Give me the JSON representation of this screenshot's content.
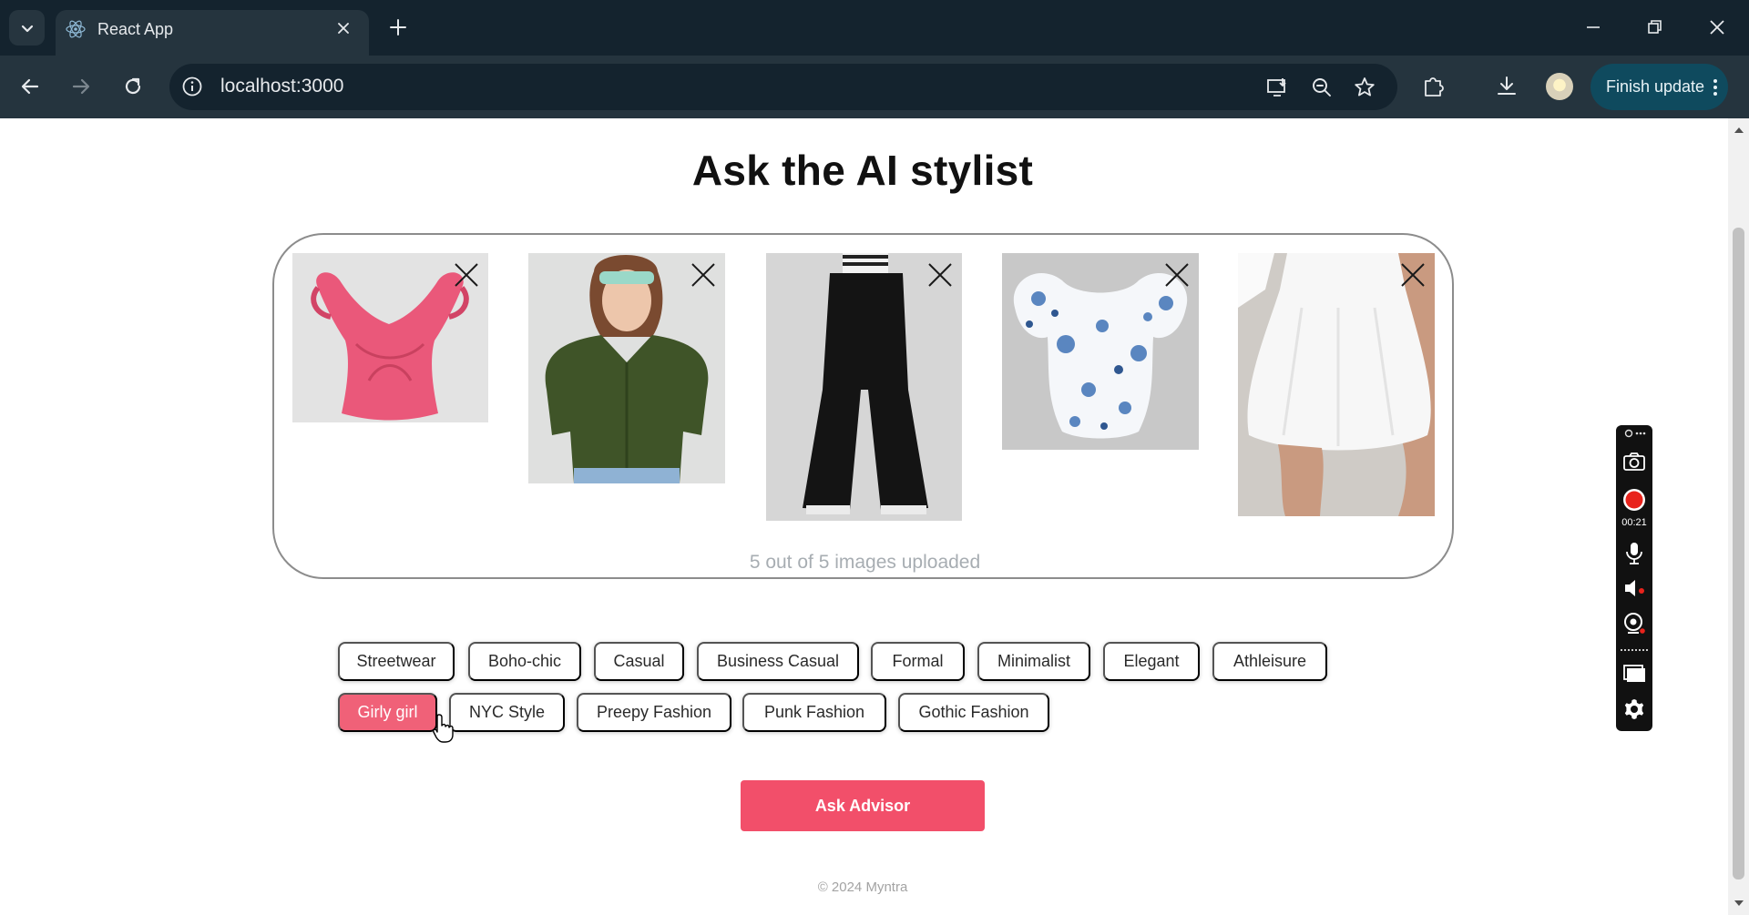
{
  "browser": {
    "tab_title": "React App",
    "url": "localhost:3000",
    "finish_update_label": "Finish update"
  },
  "page": {
    "heading": "Ask the AI stylist",
    "upload": {
      "status": "5 out of 5 images uploaded",
      "items": [
        {
          "name": "pink-ruffle-top"
        },
        {
          "name": "green-puff-sleeve-shirt"
        },
        {
          "name": "black-flare-jeans"
        },
        {
          "name": "blue-floral-corset-top"
        },
        {
          "name": "white-flared-skirt"
        }
      ]
    },
    "style_options": [
      {
        "label": "Streetwear",
        "selected": false
      },
      {
        "label": "Boho-chic",
        "selected": false
      },
      {
        "label": "Casual",
        "selected": false
      },
      {
        "label": "Business Casual",
        "selected": false
      },
      {
        "label": "Formal",
        "selected": false
      },
      {
        "label": "Minimalist",
        "selected": false
      },
      {
        "label": "Elegant",
        "selected": false
      },
      {
        "label": "Athleisure",
        "selected": false
      },
      {
        "label": "Girly girl",
        "selected": true
      },
      {
        "label": "NYC Style",
        "selected": false
      },
      {
        "label": "Preepy Fashion",
        "selected": false
      },
      {
        "label": "Punk Fashion",
        "selected": false
      },
      {
        "label": "Gothic Fashion",
        "selected": false
      }
    ],
    "ask_button_label": "Ask Advisor",
    "footer": "© 2024 Myntra"
  },
  "recorder": {
    "elapsed": "00:21"
  },
  "colors": {
    "accent": "#f24f6a",
    "chip_selected": "#f06178",
    "chrome_dark": "#14232e",
    "chrome_toolbar": "#25343e"
  }
}
